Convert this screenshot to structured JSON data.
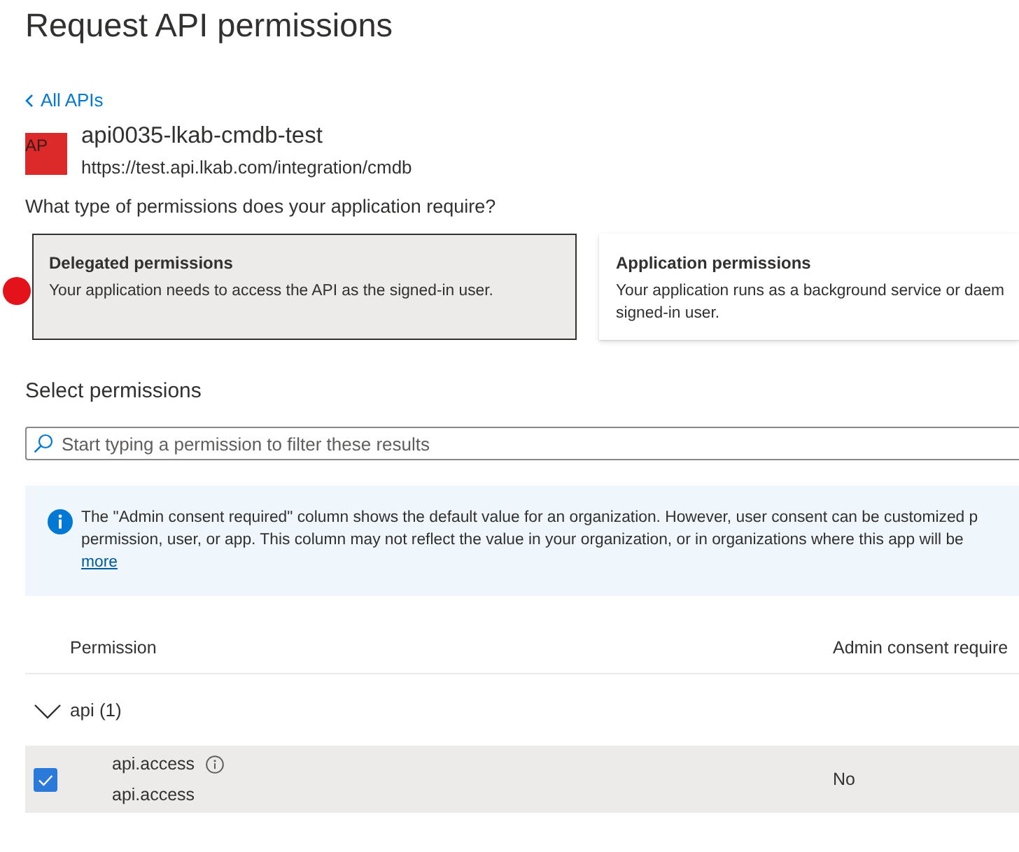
{
  "header": {
    "title": "Request API permissions"
  },
  "back_link": {
    "label": "All APIs"
  },
  "api": {
    "initials": "AP",
    "name": "api0035-lkab-cmdb-test",
    "url": "https://test.api.lkab.com/integration/cmdb"
  },
  "permission_type": {
    "question": "What type of permissions does your application require?",
    "options": [
      {
        "title": "Delegated permissions",
        "description": "Your application needs to access the API as the signed-in user.",
        "selected": true
      },
      {
        "title": "Application permissions",
        "description": "Your application runs as a background service or daem\nsigned-in user.",
        "selected": false
      }
    ]
  },
  "select_permissions": {
    "heading": "Select permissions",
    "search": {
      "placeholder": "Start typing a permission to filter these results"
    }
  },
  "info_banner": {
    "text": "The \"Admin consent required\" column shows the default value for an organization. However, user consent can be customized p\npermission, user, or app. This column may not reflect the value in your organization, or in organizations where this app will be",
    "link": "more"
  },
  "table": {
    "columns": [
      "Permission",
      "Admin consent require"
    ],
    "groups": [
      {
        "label": "api (1)",
        "expanded": true,
        "rows": [
          {
            "name": "api.access",
            "description": "api.access",
            "admin_consent": "No",
            "checked": true
          }
        ]
      }
    ]
  }
}
